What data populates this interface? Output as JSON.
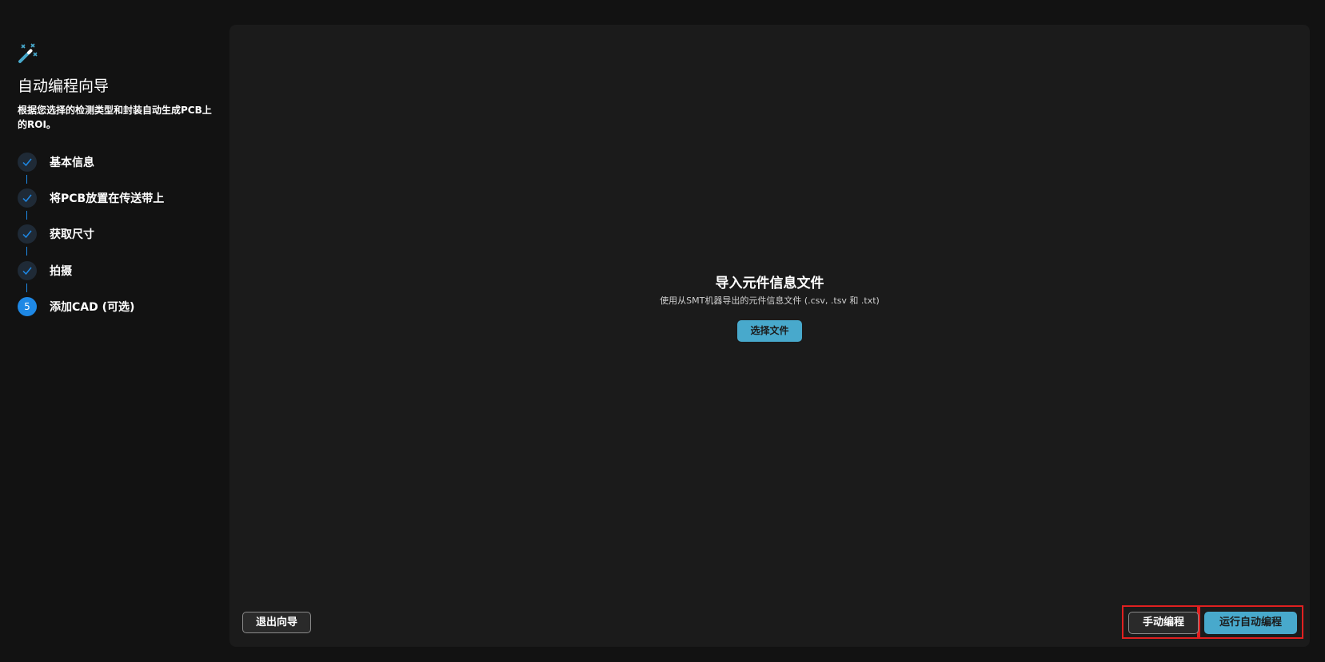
{
  "sidebar": {
    "icon": "magic-wand-icon",
    "title": "自动编程向导",
    "description": "根据您选择的检测类型和封装自动生成PCB上的ROI。",
    "steps": [
      {
        "label": "基本信息",
        "state": "done"
      },
      {
        "label": "将PCB放置在传送带上",
        "state": "done"
      },
      {
        "label": "获取尺寸",
        "state": "done"
      },
      {
        "label": "拍摄",
        "state": "done"
      },
      {
        "label": "添加CAD (可选)",
        "state": "active",
        "number": "5"
      }
    ]
  },
  "main": {
    "import_title": "导入元件信息文件",
    "import_subtitle": "使用从SMT机器导出的元件信息文件 (.csv, .tsv 和 .txt)",
    "select_file_label": "选择文件"
  },
  "footer": {
    "exit_label": "退出向导",
    "manual_label": "手动编程",
    "run_label": "运行自动编程"
  },
  "colors": {
    "accent": "#48a9cc",
    "step_active": "#1e88e5",
    "highlight": "#e02020"
  }
}
